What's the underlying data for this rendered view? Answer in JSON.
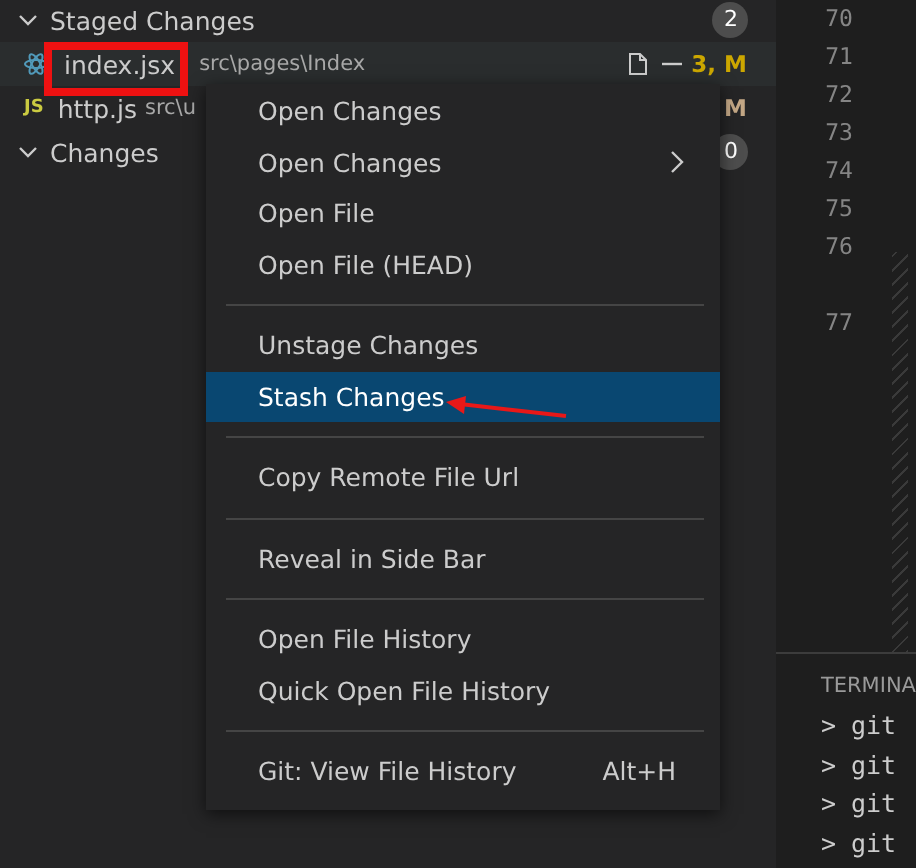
{
  "sidebar": {
    "sections": [
      {
        "title": "Staged Changes",
        "expanded": true,
        "count": "2",
        "files": [
          {
            "name": "index.jsx",
            "path": "src\\pages\\Index",
            "status": "3, M",
            "color": "#cca700",
            "kind": "react",
            "selected": true
          },
          {
            "name": "http.js",
            "path": "src\\u",
            "status": "M",
            "color": "#c4a886",
            "kind": "label",
            "icon_label": "JS",
            "selected": false
          }
        ]
      },
      {
        "title": "Changes",
        "expanded": true,
        "count": "0"
      }
    ]
  },
  "context_menu": {
    "groups": [
      [
        {
          "label": "Open Changes",
          "submenu": false,
          "selected": false
        },
        {
          "label": "Open Changes",
          "submenu": true,
          "selected": false
        },
        {
          "label": "Open File",
          "submenu": false,
          "selected": false
        },
        {
          "label": "Open File (HEAD)",
          "submenu": false,
          "selected": false
        }
      ],
      [
        {
          "label": "Unstage Changes",
          "submenu": false,
          "selected": false
        },
        {
          "label": "Stash Changes",
          "submenu": false,
          "selected": true
        }
      ],
      [
        {
          "label": "Copy Remote File Url",
          "submenu": false,
          "selected": false
        }
      ],
      [
        {
          "label": "Reveal in Side Bar",
          "submenu": false,
          "selected": false
        }
      ],
      [
        {
          "label": "Open File History",
          "submenu": false,
          "selected": false
        },
        {
          "label": "Quick Open File History",
          "submenu": false,
          "selected": false
        }
      ],
      [
        {
          "label": "Git: View File History",
          "shortcut": "Alt+H",
          "submenu": false,
          "selected": false
        }
      ]
    ]
  },
  "editor": {
    "lines": [
      {
        "number": "70",
        "wrapped": false
      },
      {
        "number": "71",
        "wrapped": false
      },
      {
        "number": "72",
        "wrapped": false
      },
      {
        "number": "73",
        "wrapped": false
      },
      {
        "number": "74",
        "wrapped": false
      },
      {
        "number": "75",
        "wrapped": false
      },
      {
        "number": "76",
        "wrapped": true
      },
      {
        "number": "77",
        "wrapped": false
      }
    ]
  },
  "terminal": {
    "title": "TERMINA",
    "lines": [
      "> git",
      "> git",
      "> git",
      "> git"
    ]
  }
}
